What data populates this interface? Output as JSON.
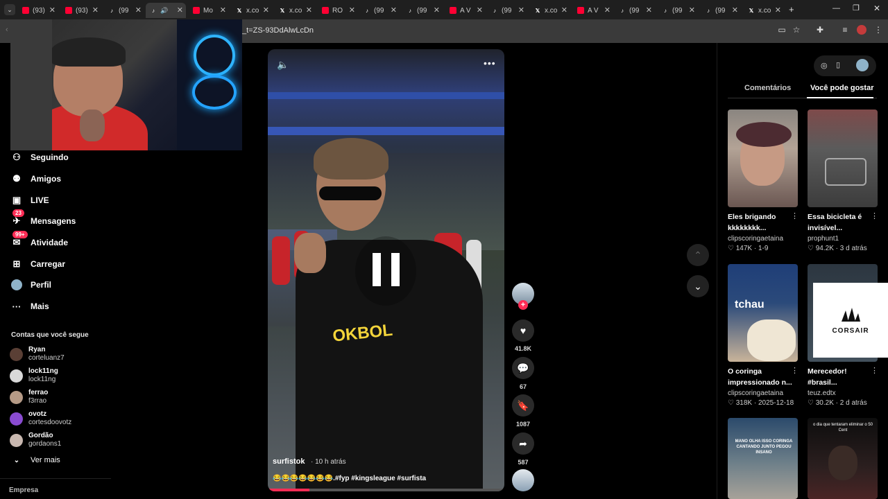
{
  "tabs": [
    {
      "label": "(93)",
      "type": "youtube"
    },
    {
      "label": "(93)",
      "type": "youtube"
    },
    {
      "label": "(99",
      "type": "tiktok"
    },
    {
      "label": "",
      "type": "tiktok-active"
    },
    {
      "label": "Mo",
      "type": "youtube"
    },
    {
      "label": "x.co",
      "type": "x"
    },
    {
      "label": "x.co",
      "type": "x"
    },
    {
      "label": "RO",
      "type": "youtube"
    },
    {
      "label": "(99",
      "type": "tiktok"
    },
    {
      "label": "(99",
      "type": "tiktok"
    },
    {
      "label": "A V",
      "type": "youtube"
    },
    {
      "label": "(99",
      "type": "tiktok"
    },
    {
      "label": "x.co",
      "type": "x"
    },
    {
      "label": "A V",
      "type": "youtube"
    },
    {
      "label": "(99",
      "type": "tiktok"
    },
    {
      "label": "(99",
      "type": "tiktok"
    },
    {
      "label": "(99",
      "type": "tiktok"
    },
    {
      "label": "x.co",
      "type": "x"
    }
  ],
  "address": {
    "url": "_t=ZS-93DdAlwLcDn"
  },
  "sidebar": {
    "items": [
      {
        "label": "Seguindo",
        "icon": "person-plus-icon"
      },
      {
        "label": "Amigos",
        "icon": "friends-icon"
      },
      {
        "label": "LIVE",
        "icon": "live-icon"
      },
      {
        "label": "Mensagens",
        "icon": "message-icon",
        "badge": "23"
      },
      {
        "label": "Atividade",
        "icon": "activity-icon",
        "badge": "99+"
      },
      {
        "label": "Carregar",
        "icon": "upload-icon"
      },
      {
        "label": "Perfil",
        "icon": "profile-avatar-icon"
      },
      {
        "label": "Mais",
        "icon": "more-icon"
      }
    ],
    "following_title": "Contas que você segue",
    "accounts": [
      {
        "name": "Ryan",
        "handle": "corteluanz7"
      },
      {
        "name": "lock11ng",
        "handle": "lock11ng"
      },
      {
        "name": "ferrao",
        "handle": "f3rrao"
      },
      {
        "name": "ovotz",
        "handle": "cortesdoovotz"
      },
      {
        "name": "Gordão",
        "handle": "gordaons1"
      }
    ],
    "see_more": "Ver mais",
    "footer": "Empresa"
  },
  "video": {
    "user": "surfistok",
    "time": "· 10 h atrás",
    "caption": "😂😂😂😂😂😂😂.#fyp #kingsleague #surfista",
    "shirt_text": "OKBOL"
  },
  "actions": {
    "likes": "41.8K",
    "comments": "67",
    "saves": "1087",
    "shares": "587"
  },
  "right_panel": {
    "tab_comments": "Comentários",
    "tab_suggest": "Você pode gostar",
    "cards": [
      {
        "title": "Eles brigando kkkkkkkk...",
        "author": "clipscoringaetaina",
        "likes": "147K",
        "date": "1-9"
      },
      {
        "title": "Essa bicicleta é invisível...",
        "author": "prophunt1",
        "likes": "94.2K",
        "date": "3 d atrás"
      },
      {
        "title": "O coringa impressionado n...",
        "author": "clipscoringaetaina",
        "likes": "318K",
        "date": "2025-12-18",
        "overlay": "tchau"
      },
      {
        "title": "Merecedor! #brasil...",
        "author": "teuz.edtx",
        "likes": "30.2K",
        "date": "2 d atrás"
      },
      {
        "title": "",
        "author": "",
        "likes": "",
        "date": "",
        "overlay": "MANO OLHA ISSO CORINGA CANTANDO JUNTO PEGOU INSANO"
      },
      {
        "title": "",
        "author": "",
        "likes": "",
        "date": "",
        "overlay": "o dia que tentaram eliminar o 50 Cent"
      }
    ]
  },
  "ad": {
    "brand": "CORSAIR"
  }
}
